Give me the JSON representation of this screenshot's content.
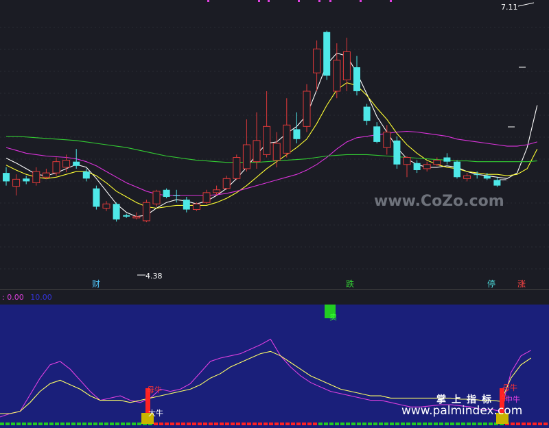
{
  "chart_data": [
    {
      "type": "candlestick",
      "title": "",
      "price_range": [
        3.6,
        7.3
      ],
      "annotations": {
        "high_label": "7.11",
        "low_label": "4.38"
      },
      "markers": [
        "财",
        "跌",
        "停",
        "涨"
      ],
      "watermark": "www.CoZo.com",
      "candles": [
        {
          "o": 5.04,
          "c": 4.92,
          "h": 5.12,
          "l": 4.86,
          "up": false
        },
        {
          "o": 4.85,
          "c": 4.95,
          "h": 5.02,
          "l": 4.72,
          "up": true
        },
        {
          "o": 4.92,
          "c": 4.96,
          "h": 5.0,
          "l": 4.88,
          "up": false
        },
        {
          "o": 4.9,
          "c": 5.06,
          "h": 5.12,
          "l": 4.86,
          "up": true
        },
        {
          "o": 4.98,
          "c": 5.04,
          "h": 5.1,
          "l": 4.95,
          "up": true
        },
        {
          "o": 5.04,
          "c": 5.2,
          "h": 5.26,
          "l": 5.0,
          "up": true
        },
        {
          "o": 5.12,
          "c": 5.22,
          "h": 5.3,
          "l": 5.05,
          "up": true
        },
        {
          "o": 5.2,
          "c": 5.14,
          "h": 5.38,
          "l": 5.1,
          "up": false
        },
        {
          "o": 5.06,
          "c": 4.96,
          "h": 5.1,
          "l": 4.92,
          "up": false
        },
        {
          "o": 4.82,
          "c": 4.56,
          "h": 4.86,
          "l": 4.52,
          "up": false
        },
        {
          "o": 4.54,
          "c": 4.6,
          "h": 4.64,
          "l": 4.5,
          "up": true
        },
        {
          "o": 4.6,
          "c": 4.38,
          "h": 4.62,
          "l": 4.35,
          "up": false
        },
        {
          "o": 4.42,
          "c": 4.44,
          "h": 4.46,
          "l": 4.4,
          "up": false
        },
        {
          "o": 4.42,
          "c": 4.4,
          "h": 4.48,
          "l": 4.38,
          "up": true
        },
        {
          "o": 4.36,
          "c": 4.62,
          "h": 4.66,
          "l": 4.34,
          "up": true
        },
        {
          "o": 4.6,
          "c": 4.78,
          "h": 4.8,
          "l": 4.56,
          "up": true
        },
        {
          "o": 4.8,
          "c": 4.7,
          "h": 4.82,
          "l": 4.68,
          "up": false
        },
        {
          "o": 4.72,
          "c": 4.72,
          "h": 4.8,
          "l": 4.62,
          "up": false
        },
        {
          "o": 4.66,
          "c": 4.52,
          "h": 4.7,
          "l": 4.48,
          "up": false
        },
        {
          "o": 4.52,
          "c": 4.6,
          "h": 4.62,
          "l": 4.5,
          "up": true
        },
        {
          "o": 4.62,
          "c": 4.76,
          "h": 4.8,
          "l": 4.6,
          "up": true
        },
        {
          "o": 4.76,
          "c": 4.8,
          "h": 4.86,
          "l": 4.72,
          "up": true
        },
        {
          "o": 4.82,
          "c": 4.96,
          "h": 5.0,
          "l": 4.8,
          "up": true
        },
        {
          "o": 4.96,
          "c": 5.26,
          "h": 5.3,
          "l": 4.94,
          "up": true
        },
        {
          "o": 5.1,
          "c": 5.44,
          "h": 5.8,
          "l": 5.06,
          "up": true
        },
        {
          "o": 5.2,
          "c": 5.5,
          "h": 5.9,
          "l": 5.1,
          "up": true
        },
        {
          "o": 5.3,
          "c": 5.7,
          "h": 6.2,
          "l": 5.26,
          "up": true
        },
        {
          "o": 5.22,
          "c": 5.46,
          "h": 5.62,
          "l": 5.12,
          "up": true
        },
        {
          "o": 5.32,
          "c": 5.72,
          "h": 6.1,
          "l": 5.26,
          "up": true
        },
        {
          "o": 5.66,
          "c": 5.52,
          "h": 5.9,
          "l": 5.46,
          "up": false
        },
        {
          "o": 5.7,
          "c": 6.2,
          "h": 6.3,
          "l": 5.62,
          "up": true
        },
        {
          "o": 6.46,
          "c": 6.8,
          "h": 6.92,
          "l": 6.2,
          "up": true
        },
        {
          "o": 7.04,
          "c": 6.42,
          "h": 7.06,
          "l": 6.36,
          "up": false
        },
        {
          "o": 6.2,
          "c": 6.64,
          "h": 6.88,
          "l": 6.1,
          "up": true
        },
        {
          "o": 6.36,
          "c": 6.76,
          "h": 6.96,
          "l": 6.2,
          "up": true
        },
        {
          "o": 6.54,
          "c": 6.2,
          "h": 6.7,
          "l": 6.14,
          "up": false
        },
        {
          "o": 5.98,
          "c": 5.78,
          "h": 6.02,
          "l": 5.72,
          "up": false
        },
        {
          "o": 5.7,
          "c": 5.48,
          "h": 5.76,
          "l": 5.46,
          "up": false
        },
        {
          "o": 5.4,
          "c": 5.62,
          "h": 5.72,
          "l": 5.3,
          "up": true
        },
        {
          "o": 5.5,
          "c": 5.16,
          "h": 5.56,
          "l": 5.1,
          "up": false
        },
        {
          "o": 5.26,
          "c": 5.16,
          "h": 5.28,
          "l": 4.98,
          "up": true
        },
        {
          "o": 5.18,
          "c": 5.08,
          "h": 5.22,
          "l": 5.04,
          "up": false
        },
        {
          "o": 5.1,
          "c": 5.16,
          "h": 5.2,
          "l": 5.06,
          "up": true
        },
        {
          "o": 5.16,
          "c": 5.22,
          "h": 5.26,
          "l": 5.14,
          "up": true
        },
        {
          "o": 5.26,
          "c": 5.2,
          "h": 5.32,
          "l": 5.16,
          "up": false
        },
        {
          "o": 5.2,
          "c": 4.98,
          "h": 5.22,
          "l": 4.96,
          "up": false
        },
        {
          "o": 4.96,
          "c": 5.0,
          "h": 5.04,
          "l": 4.92,
          "up": true
        },
        {
          "o": 5.02,
          "c": 5.02,
          "h": 5.06,
          "l": 4.96,
          "up": false
        },
        {
          "o": 5.0,
          "c": 4.96,
          "h": 5.04,
          "l": 4.94,
          "up": false
        },
        {
          "o": 4.94,
          "c": 4.86,
          "h": 4.98,
          "l": 4.84,
          "up": false
        }
      ],
      "ma_lines": [
        {
          "color": "#ffffff",
          "values": [
            5.25,
            5.18,
            5.1,
            5.02,
            5.0,
            5.04,
            5.1,
            5.16,
            5.12,
            4.96,
            4.78,
            4.6,
            4.48,
            4.42,
            4.44,
            4.54,
            4.62,
            4.66,
            4.64,
            4.6,
            4.64,
            4.72,
            4.82,
            4.96,
            5.12,
            5.3,
            5.46,
            5.48,
            5.6,
            5.7,
            5.86,
            6.22,
            6.58,
            6.74,
            6.7,
            6.46,
            6.16,
            5.84,
            5.62,
            5.4,
            5.24,
            5.16,
            5.12,
            5.12,
            5.14,
            5.12,
            5.06,
            5.02,
            5.0,
            4.98,
            4.96,
            5.04,
            5.4,
            6.0
          ]
        },
        {
          "color": "#ffff33",
          "values": [
            5.15,
            5.08,
            5.02,
            4.98,
            4.96,
            4.98,
            5.02,
            5.06,
            5.06,
            5.0,
            4.9,
            4.78,
            4.7,
            4.62,
            4.56,
            4.54,
            4.56,
            4.58,
            4.58,
            4.58,
            4.58,
            4.62,
            4.68,
            4.76,
            4.86,
            4.98,
            5.1,
            5.2,
            5.3,
            5.4,
            5.52,
            5.74,
            6.0,
            6.22,
            6.32,
            6.28,
            6.14,
            5.96,
            5.8,
            5.6,
            5.44,
            5.32,
            5.22,
            5.16,
            5.12,
            5.1,
            5.06,
            5.04,
            5.02,
            5.02,
            5.0,
            5.02,
            5.1,
            5.38
          ]
        },
        {
          "color": "#dd33dd",
          "values": [
            5.4,
            5.36,
            5.32,
            5.3,
            5.28,
            5.27,
            5.26,
            5.24,
            5.2,
            5.14,
            5.06,
            4.98,
            4.9,
            4.84,
            4.78,
            4.74,
            4.72,
            4.72,
            4.72,
            4.72,
            4.72,
            4.73,
            4.75,
            4.78,
            4.82,
            4.86,
            4.9,
            4.94,
            4.98,
            5.02,
            5.08,
            5.16,
            5.26,
            5.38,
            5.48,
            5.54,
            5.56,
            5.58,
            5.6,
            5.62,
            5.63,
            5.62,
            5.6,
            5.58,
            5.56,
            5.52,
            5.5,
            5.48,
            5.46,
            5.44,
            5.42,
            5.42,
            5.44,
            5.48
          ]
        },
        {
          "color": "#33cc33",
          "values": [
            5.56,
            5.56,
            5.55,
            5.54,
            5.53,
            5.52,
            5.51,
            5.5,
            5.48,
            5.46,
            5.44,
            5.42,
            5.4,
            5.37,
            5.34,
            5.31,
            5.28,
            5.26,
            5.24,
            5.22,
            5.21,
            5.2,
            5.19,
            5.19,
            5.19,
            5.19,
            5.2,
            5.21,
            5.22,
            5.23,
            5.24,
            5.26,
            5.28,
            5.29,
            5.3,
            5.3,
            5.3,
            5.29,
            5.28,
            5.27,
            5.26,
            5.25,
            5.24,
            5.23,
            5.22,
            5.21,
            5.21,
            5.2,
            5.2,
            5.2,
            5.2,
            5.2,
            5.2,
            5.21
          ]
        }
      ]
    },
    {
      "type": "line",
      "title": "",
      "header_values": [
        ": 0.00",
        "10.00"
      ],
      "range": [
        0,
        100
      ],
      "series": [
        {
          "color": "#e040e0",
          "values": [
            5,
            8,
            10,
            25,
            40,
            52,
            55,
            48,
            38,
            28,
            20,
            22,
            24,
            20,
            18,
            22,
            30,
            28,
            30,
            35,
            45,
            55,
            58,
            60,
            62,
            66,
            70,
            75,
            60,
            50,
            42,
            36,
            32,
            28,
            26,
            24,
            22,
            20,
            20,
            18,
            16,
            14,
            14,
            15,
            16,
            16,
            15,
            14,
            12,
            12,
            10,
            45,
            60,
            65
          ]
        },
        {
          "color": "#ffff66",
          "values": [
            8,
            8,
            10,
            18,
            28,
            35,
            38,
            34,
            30,
            24,
            20,
            20,
            20,
            18,
            20,
            22,
            24,
            26,
            28,
            30,
            34,
            40,
            44,
            50,
            54,
            58,
            62,
            64,
            60,
            54,
            48,
            42,
            38,
            34,
            30,
            28,
            26,
            24,
            24,
            22,
            22,
            22,
            22,
            22,
            22,
            22,
            21,
            21,
            20,
            20,
            19,
            40,
            52,
            58
          ]
        }
      ],
      "labels": {
        "sell": "卖",
        "bull_a": "母牛",
        "bull_b": "大牛",
        "bull_c": "母牛",
        "bull_d": "牛",
        "bull_e": "中牛"
      },
      "watermark_cn": "掌上指标",
      "watermark_url": "www.palmindex.com"
    }
  ]
}
